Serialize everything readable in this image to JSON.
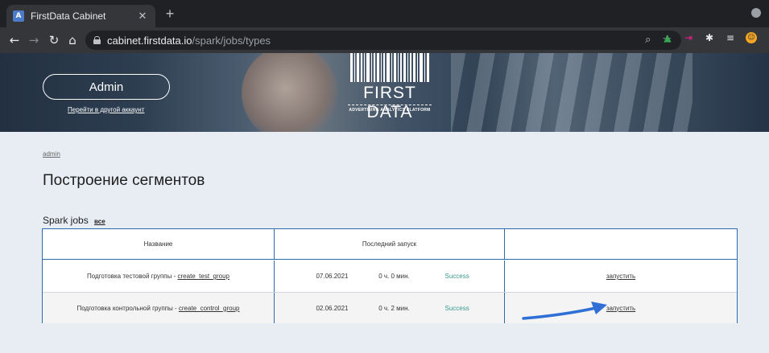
{
  "browser": {
    "tab_title": "FirstData Cabinet",
    "tab_favicon_letter": "A",
    "url_host": "cabinet.firstdata.io",
    "url_path": "/spark/jobs/types"
  },
  "header": {
    "account_label": "Admin",
    "switch_account_link": "Перейти в другой аккаунт",
    "logo_word": "FIRST DATA",
    "logo_tagline": "ADVERTISING ANALYTICS PLATFORM"
  },
  "breadcrumb": "admin",
  "page_title": "Построение сегментов",
  "section": {
    "label": "Spark jobs",
    "link": "все"
  },
  "table": {
    "columns": [
      "Название",
      "Последний запуск",
      ""
    ],
    "rows": [
      {
        "name_prefix": "Подготовка тестовой группы - ",
        "job_id": "create_test_group",
        "date": "07.06.2021",
        "duration": "0 ч. 0 мин.",
        "status": "Success",
        "action": "запустить"
      },
      {
        "name_prefix": "Подготовка контрольной группы - ",
        "job_id": "create_control_group",
        "date": "02.06.2021",
        "duration": "0 ч. 2 мин.",
        "status": "Success",
        "action": "запустить"
      }
    ]
  },
  "colors": {
    "accent": "#2b6cb0",
    "status_success": "#3a9a8f",
    "arrow": "#2f6fd6"
  }
}
